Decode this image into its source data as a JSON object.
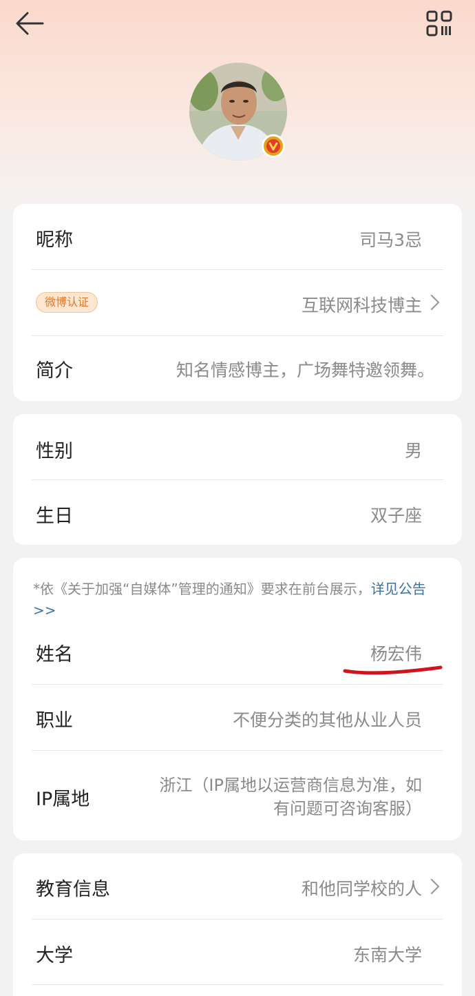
{
  "header": {
    "back_icon": "arrow-left-icon",
    "qr_icon": "qr-code-icon"
  },
  "profile": {
    "verified_badge_icon": "v-verified-icon",
    "badge_color": "#e8a019"
  },
  "card1": {
    "nickname_label": "昵称",
    "nickname_value": "司马3忌",
    "verify_badge": "微博认证",
    "verify_value": "互联网科技博主",
    "intro_label": "简介",
    "intro_value": "知名情感博主，广场舞特邀领舞。"
  },
  "card2": {
    "gender_label": "性别",
    "gender_value": "男",
    "birthday_label": "生日",
    "birthday_value": "双子座"
  },
  "card3": {
    "notice_text": "*依《关于加强“自媒体”管理的通知》要求在前台展示，",
    "notice_link": "详见公告>>",
    "name_label": "姓名",
    "name_value": "杨宏伟",
    "job_label": "职业",
    "job_value": "不便分类的其他从业人员",
    "ip_label": "IP属地",
    "ip_value_line1": "浙江（IP属地以运营商信息为准，如",
    "ip_value_line2": "有问题可咨询客服）"
  },
  "card4": {
    "edu_label": "教育信息",
    "edu_value": "和他同学校的人",
    "uni_label": "大学",
    "uni_value": "东南大学"
  },
  "colors": {
    "link": "#3a6fa8",
    "annotation_red": "#d0141c"
  }
}
